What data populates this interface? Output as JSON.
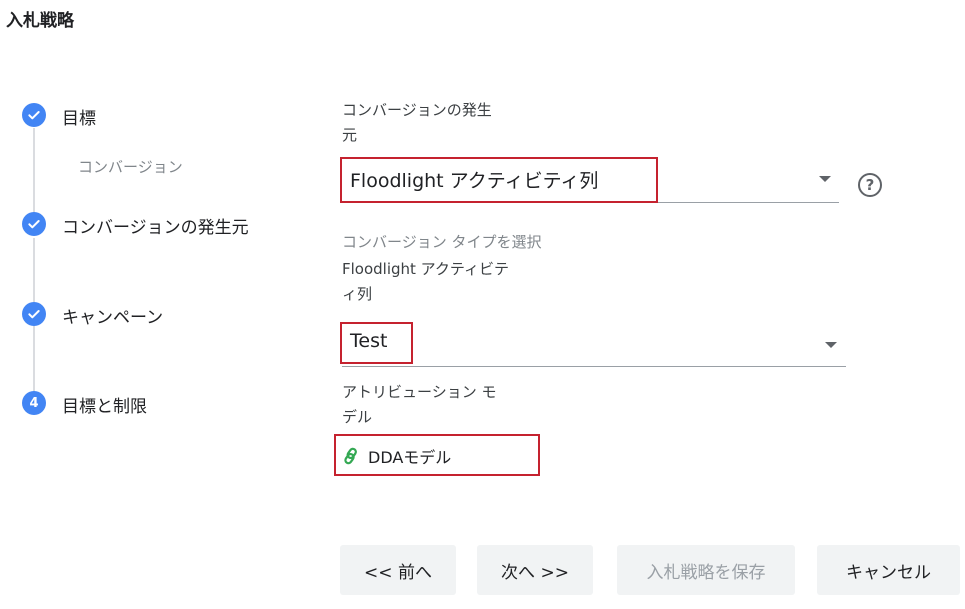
{
  "header": {
    "title": "入札戦略"
  },
  "steps": [
    {
      "label": "目標",
      "status": "done",
      "icon": "check-icon"
    },
    {
      "label": "コンバージョンの発生元",
      "status": "done",
      "icon": "check-icon"
    },
    {
      "label": "キャンペーン",
      "status": "done",
      "icon": "check-icon"
    },
    {
      "label": "目標と制限",
      "status": "current",
      "number": "4"
    }
  ],
  "substep": {
    "label": "コンバージョン"
  },
  "form": {
    "source_label_line1": "コンバージョンの発生",
    "source_label_line2": "元",
    "source_value": "Floodlight アクティビティ列",
    "type_label": "コンバージョン タイプを選択",
    "type_sublabel_line1": "Floodlight アクティビテ",
    "type_sublabel_line2": "ィ列",
    "type_value": "Test",
    "attribution_label_line1": "アトリビューション モ",
    "attribution_label_line2": "デル",
    "attribution_value": "DDAモデル",
    "help_glyph": "?"
  },
  "buttons": {
    "prev": "<< 前へ",
    "next": "次へ >>",
    "save": "入札戦略を保存",
    "cancel": "キャンセル"
  },
  "colors": {
    "accent": "#4285f4",
    "highlight": "#c5222f",
    "link_icon": "#34a853"
  }
}
